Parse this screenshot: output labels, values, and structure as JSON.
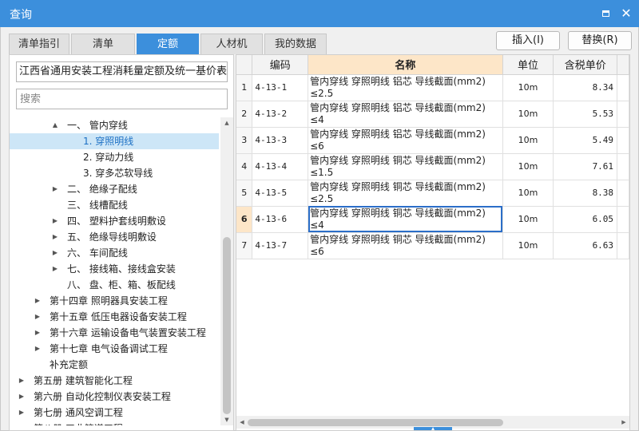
{
  "window": {
    "title": "查询",
    "max_glyph": "maximize",
    "close_glyph": "✕"
  },
  "tabs": [
    {
      "label": "清单指引"
    },
    {
      "label": "清单"
    },
    {
      "label": "定额",
      "active": true
    },
    {
      "label": "人材机"
    },
    {
      "label": "我的数据"
    }
  ],
  "buttons": {
    "insert": "插入(I)",
    "replace": "替换(R)"
  },
  "left": {
    "library": "江西省通用安装工程消耗量定额及统一基价表(",
    "search_placeholder": "搜索",
    "tree": [
      {
        "label": "一、 管内穿线",
        "expander": "▲",
        "level": 4
      },
      {
        "label": "1. 穿照明线",
        "expander": "",
        "level": 5,
        "selected": true
      },
      {
        "label": "2. 穿动力线",
        "expander": "",
        "level": 5
      },
      {
        "label": "3. 穿多芯软导线",
        "expander": "",
        "level": 5
      },
      {
        "label": "二、 绝缘子配线",
        "expander": "▶",
        "level": 4
      },
      {
        "label": "三、 线槽配线",
        "expander": "",
        "level": 4
      },
      {
        "label": "四、 塑料护套线明敷设",
        "expander": "▶",
        "level": 4
      },
      {
        "label": "五、 绝缘导线明敷设",
        "expander": "▶",
        "level": 4
      },
      {
        "label": "六、 车间配线",
        "expander": "▶",
        "level": 4
      },
      {
        "label": "七、 接线箱、接线盒安装",
        "expander": "▶",
        "level": 4
      },
      {
        "label": "八、 盘、柜、箱、板配线",
        "expander": "",
        "level": 4
      },
      {
        "label": "第十四章 照明器具安装工程",
        "expander": "▶",
        "level": 3
      },
      {
        "label": "第十五章 低压电器设备安装工程",
        "expander": "▶",
        "level": 3
      },
      {
        "label": "第十六章 运输设备电气装置安装工程",
        "expander": "▶",
        "level": 3
      },
      {
        "label": "第十七章 电气设备调试工程",
        "expander": "▶",
        "level": 3
      },
      {
        "label": "补充定额",
        "expander": "",
        "level": 3
      },
      {
        "label": "第五册 建筑智能化工程",
        "expander": "▶",
        "level": 2
      },
      {
        "label": "第六册 自动化控制仪表安装工程",
        "expander": "▶",
        "level": 2
      },
      {
        "label": "第七册 通风空调工程",
        "expander": "▶",
        "level": 2
      },
      {
        "label": "第八册 工业管道工程",
        "expander": "▶",
        "level": 2
      }
    ]
  },
  "grid": {
    "headers": {
      "index": "",
      "code": "编码",
      "name": "名称",
      "unit": "单位",
      "price": "含税单价",
      "extra": ""
    },
    "rows": [
      {
        "index": "1",
        "code": "4-13-1",
        "name_l1": "管内穿线 穿照明线 铝芯 导线截面(mm2)",
        "name_l2": "≤2.5",
        "unit": "10m",
        "price": "8.34"
      },
      {
        "index": "2",
        "code": "4-13-2",
        "name_l1": "管内穿线 穿照明线 铝芯 导线截面(mm2)",
        "name_l2": "≤4",
        "unit": "10m",
        "price": "5.53"
      },
      {
        "index": "3",
        "code": "4-13-3",
        "name_l1": "管内穿线 穿照明线 铝芯 导线截面(mm2)",
        "name_l2": "≤6",
        "unit": "10m",
        "price": "5.49"
      },
      {
        "index": "4",
        "code": "4-13-4",
        "name_l1": "管内穿线 穿照明线 铜芯 导线截面(mm2)",
        "name_l2": "≤1.5",
        "unit": "10m",
        "price": "7.61"
      },
      {
        "index": "5",
        "code": "4-13-5",
        "name_l1": "管内穿线 穿照明线 铜芯 导线截面(mm2)",
        "name_l2": "≤2.5",
        "unit": "10m",
        "price": "8.38"
      },
      {
        "index": "6",
        "code": "4-13-6",
        "name_l1": "管内穿线 穿照明线 铜芯 导线截面(mm2)",
        "name_l2": "≤4",
        "unit": "10m",
        "price": "6.05",
        "current": true
      },
      {
        "index": "7",
        "code": "4-13-7",
        "name_l1": "管内穿线 穿照明线 铜芯 导线截面(mm2)",
        "name_l2": "≤6",
        "unit": "10m",
        "price": "6.63"
      }
    ]
  }
}
